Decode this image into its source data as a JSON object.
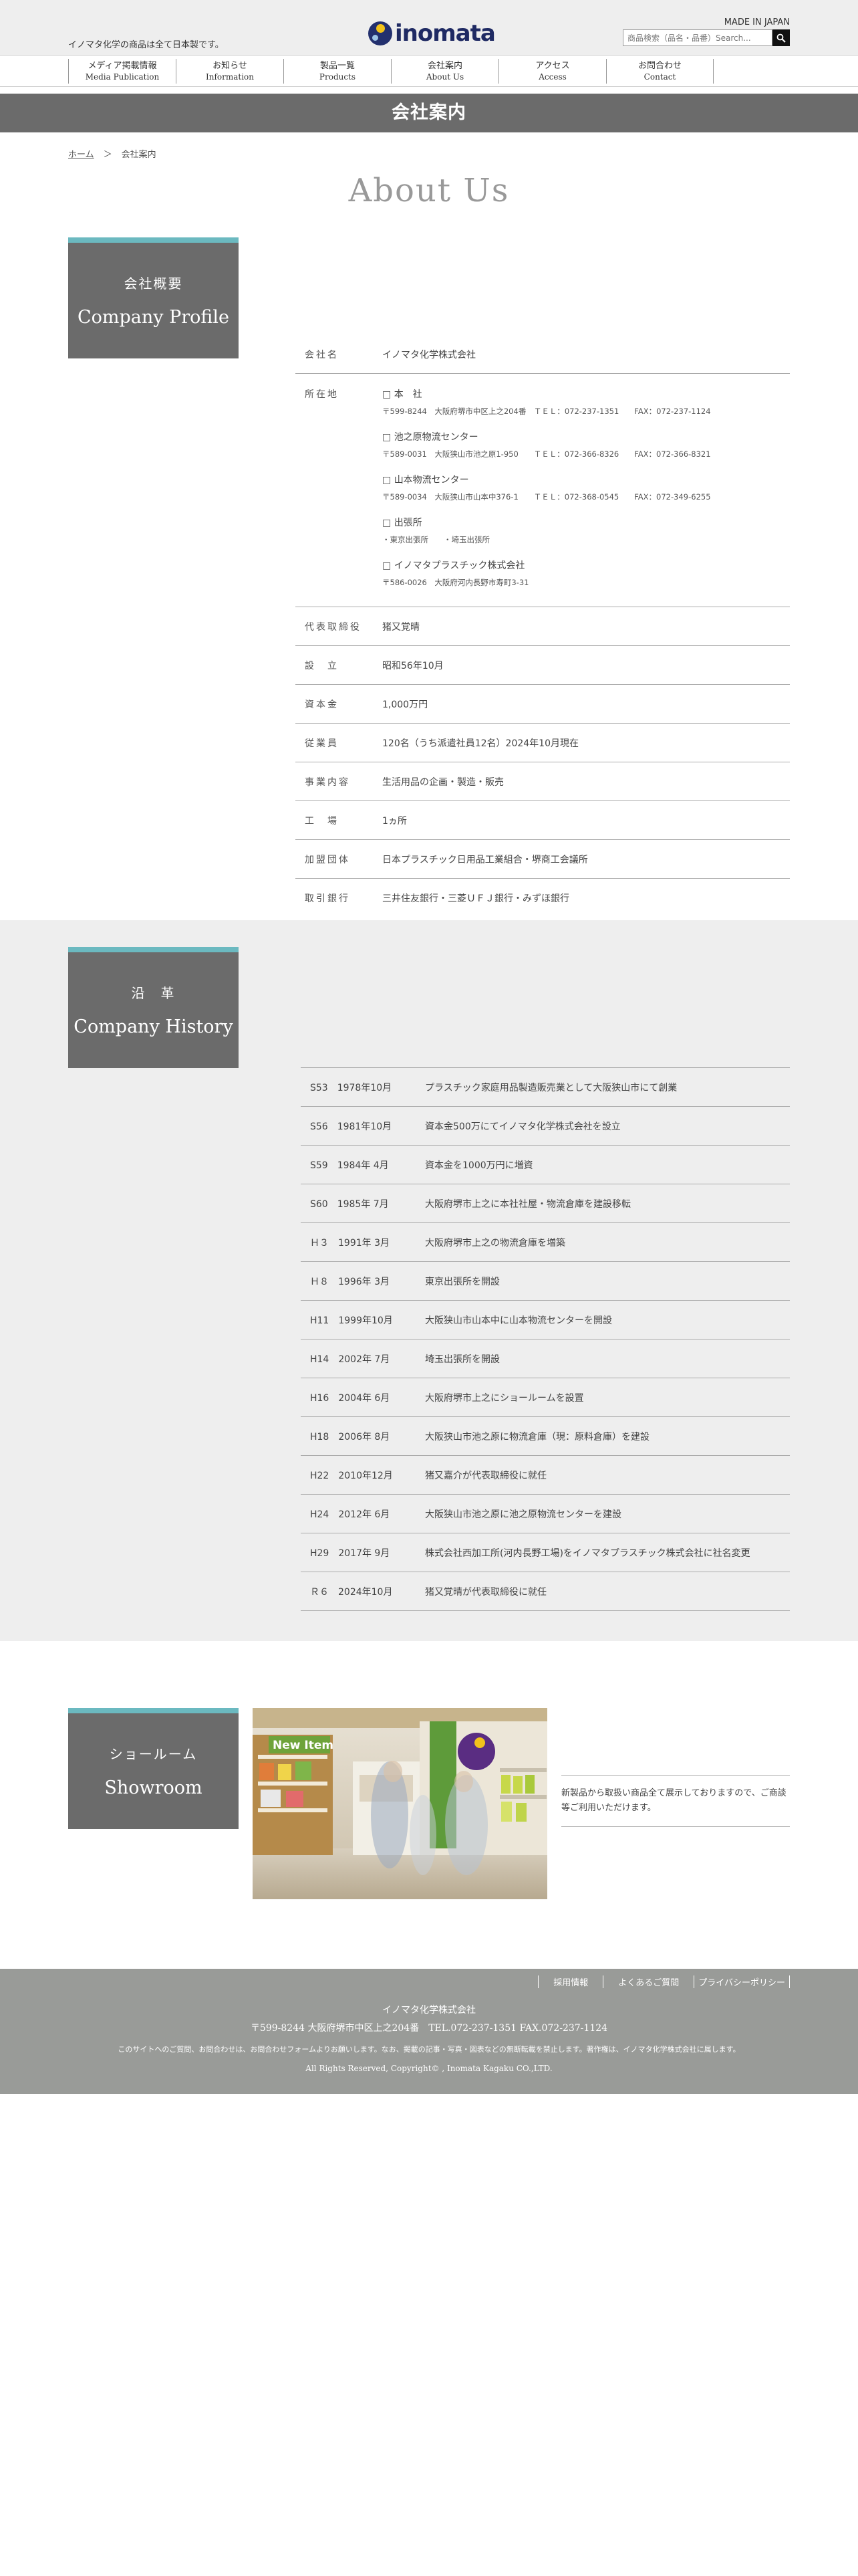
{
  "header": {
    "tagline": "イノマタ化学の商品は全て日本製です。",
    "logo_text": "inomata",
    "made_in": "MADE IN JAPAN",
    "search_placeholder": "商品検索（品名・品番）Search..."
  },
  "nav": [
    {
      "jp": "メディア掲載情報",
      "en": "Media Publication"
    },
    {
      "jp": "お知らせ",
      "en": "Information"
    },
    {
      "jp": "製品一覧",
      "en": "Products"
    },
    {
      "jp": "会社案内",
      "en": "About Us"
    },
    {
      "jp": "アクセス",
      "en": "Access"
    },
    {
      "jp": "お問合わせ",
      "en": "Contact"
    }
  ],
  "banner": "会社案内",
  "breadcrumb": {
    "home": "ホーム",
    "sep": "＞",
    "current": "会社案内"
  },
  "page_title": "About Us",
  "profile": {
    "box_jp": "会社概要",
    "box_en": "Company Profile",
    "company_label": "会社名",
    "company_value": "イノマタ化学株式会社",
    "address_label": "所在地",
    "addresses": [
      {
        "name": "本　社",
        "detail": "〒599-8244　大阪府堺市中区上之204番　ＴＥＬ：072-237-1351　　FAX：072-237-1124"
      },
      {
        "name": "池之原物流センター",
        "detail": "〒589-0031　大阪狭山市池之原1-950　　ＴＥＬ：072-366-8326　　FAX：072-366-8321"
      },
      {
        "name": "山本物流センター",
        "detail": "〒589-0034　大阪狭山市山本中376-1　　ＴＥＬ：072-368-0545　　FAX：072-349-6255"
      },
      {
        "name": "出張所",
        "detail": "・東京出張所　　・埼玉出張所"
      },
      {
        "name": "イノマタプラスチック株式会社",
        "detail": "〒586-0026　大阪府河内長野市寿町3-31"
      }
    ],
    "rows": [
      {
        "label": "代表取締役",
        "value": "猪又覚晴"
      },
      {
        "label": "設　立",
        "value": "昭和56年10月"
      },
      {
        "label": "資本金",
        "value": "1,000万円"
      },
      {
        "label": "従業員",
        "value": "120名（うち派遣社員12名）2024年10月現在"
      },
      {
        "label": "事業内容",
        "value": "生活用品の企画・製造・販売"
      },
      {
        "label": "工　場",
        "value": "1ヵ所"
      },
      {
        "label": "加盟団体",
        "value": "日本プラスチック日用品工業組合・堺商工会議所"
      },
      {
        "label": "取引銀行",
        "value": "三井住友銀行・三菱ＵＦＪ銀行・みずほ銀行"
      }
    ]
  },
  "history": {
    "box_jp": "沿　革",
    "box_en": "Company History",
    "items": [
      {
        "era": "S53　1978年10月",
        "event": "プラスチック家庭用品製造販売業として大阪狭山市にて創業"
      },
      {
        "era": "S56　1981年10月",
        "event": "資本金500万にてイノマタ化学株式会社を設立"
      },
      {
        "era": "S59　1984年 4月",
        "event": "資本金を1000万円に増資"
      },
      {
        "era": "S60　1985年 7月",
        "event": "大阪府堺市上之に本社社屋・物流倉庫を建設移転"
      },
      {
        "era": "Ｈ３　1991年 3月",
        "event": "大阪府堺市上之の物流倉庫を増築"
      },
      {
        "era": "Ｈ８　1996年 3月",
        "event": "東京出張所を開設"
      },
      {
        "era": "H11　1999年10月",
        "event": "大阪狭山市山本中に山本物流センターを開設"
      },
      {
        "era": "H14　2002年 7月",
        "event": "埼玉出張所を開設"
      },
      {
        "era": "H16　2004年 6月",
        "event": "大阪府堺市上之にショールームを設置"
      },
      {
        "era": "H18　2006年 8月",
        "event": "大阪狭山市池之原に物流倉庫（現：原料倉庫）を建設"
      },
      {
        "era": "H22　2010年12月",
        "event": "猪又嘉介が代表取締役に就任"
      },
      {
        "era": "H24　2012年 6月",
        "event": "大阪狭山市池之原に池之原物流センターを建設"
      },
      {
        "era": "H29　2017年 9月",
        "event": "株式会社西加工所(河内長野工場)をイノマタプラスチック株式会社に社名変更"
      },
      {
        "era": "Ｒ６　2024年10月",
        "event": "猪又覚晴が代表取締役に就任"
      }
    ]
  },
  "showroom": {
    "box_jp": "ショールーム",
    "box_en": "Showroom",
    "text": "新製品から取扱い商品全て展示しておりますので、ご商談等ご利用いただけます。",
    "photo_sign": "New Item"
  },
  "footer": {
    "links": [
      "採用情報",
      "よくあるご質問",
      "プライバシーポリシー"
    ],
    "company": "イノマタ化学株式会社",
    "address": "〒599-8244 大阪府堺市中区上之204番　TEL.072-237-1351 FAX.072-237-1124",
    "note": "このサイトへのご質問、お問合わせは、お問合わせフォームよりお願いします。なお、掲載の記事・写真・図表などの無断転載を禁止します。著作権は、イノマタ化学株式会社に属します。",
    "copyright": "All Rights Reserved, Copyright© , Inomata Kagaku CO.,LTD."
  }
}
